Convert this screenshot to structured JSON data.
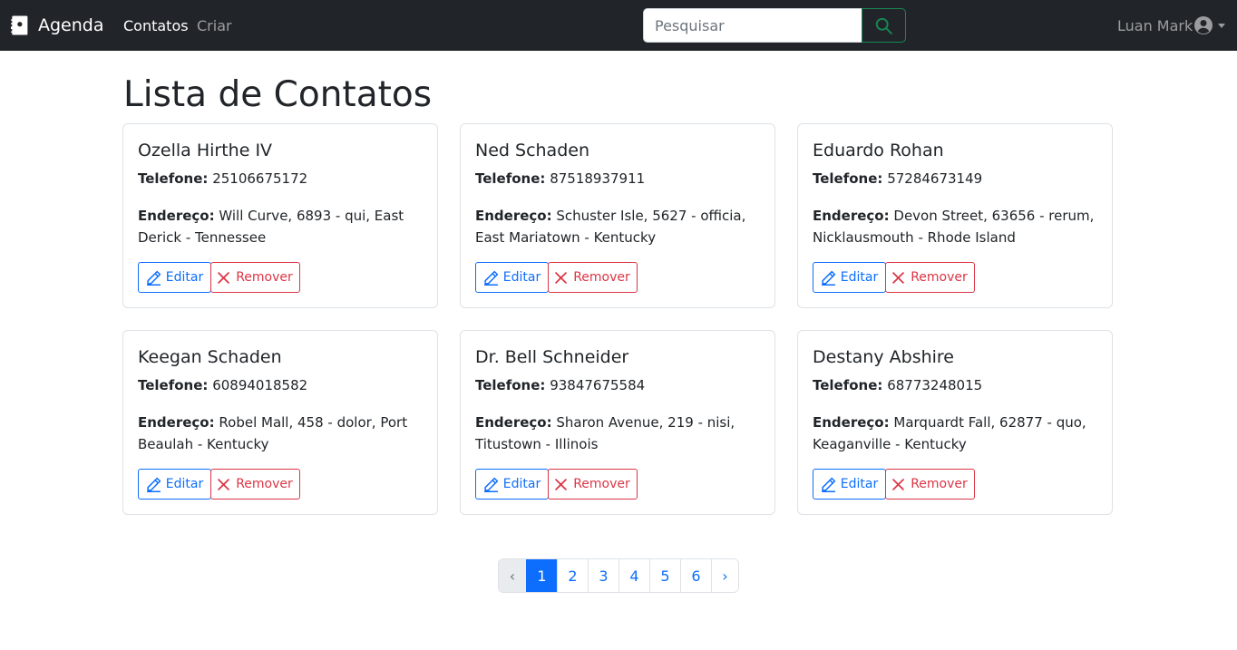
{
  "navbar": {
    "brand": "Agenda",
    "links": [
      {
        "label": "Contatos",
        "active": true
      },
      {
        "label": "Criar",
        "active": false
      }
    ],
    "search": {
      "placeholder": "Pesquisar",
      "value": ""
    },
    "user": "Luan Mark"
  },
  "page_title": "Lista de Contatos",
  "labels": {
    "phone": "Telefone:",
    "address": "Endereço:",
    "edit": "Editar",
    "remove": "Remover"
  },
  "contacts": [
    {
      "name": "Ozella Hirthe IV",
      "phone": "25106675172",
      "address": "Will Curve, 6893 - qui, East Derick - Tennessee"
    },
    {
      "name": "Ned Schaden",
      "phone": "87518937911",
      "address": "Schuster Isle, 5627 - officia, East Mariatown - Kentucky"
    },
    {
      "name": "Eduardo Rohan",
      "phone": "57284673149",
      "address": "Devon Street, 63656 - rerum, Nicklausmouth - Rhode Island"
    },
    {
      "name": "Keegan Schaden",
      "phone": "60894018582",
      "address": "Robel Mall, 458 - dolor, Port Beaulah - Kentucky"
    },
    {
      "name": "Dr. Bell Schneider",
      "phone": "93847675584",
      "address": "Sharon Avenue, 219 - nisi, Titustown - Illinois"
    },
    {
      "name": "Destany Abshire",
      "phone": "68773248015",
      "address": "Marquardt Fall, 62877 - quo, Keaganville - Kentucky"
    }
  ],
  "pagination": {
    "prev": "‹",
    "next": "›",
    "pages": [
      "1",
      "2",
      "3",
      "4",
      "5",
      "6"
    ],
    "current": "1"
  },
  "colors": {
    "navbar_bg": "#212529",
    "primary": "#0d6efd",
    "danger": "#dc3545",
    "success": "#198754"
  }
}
